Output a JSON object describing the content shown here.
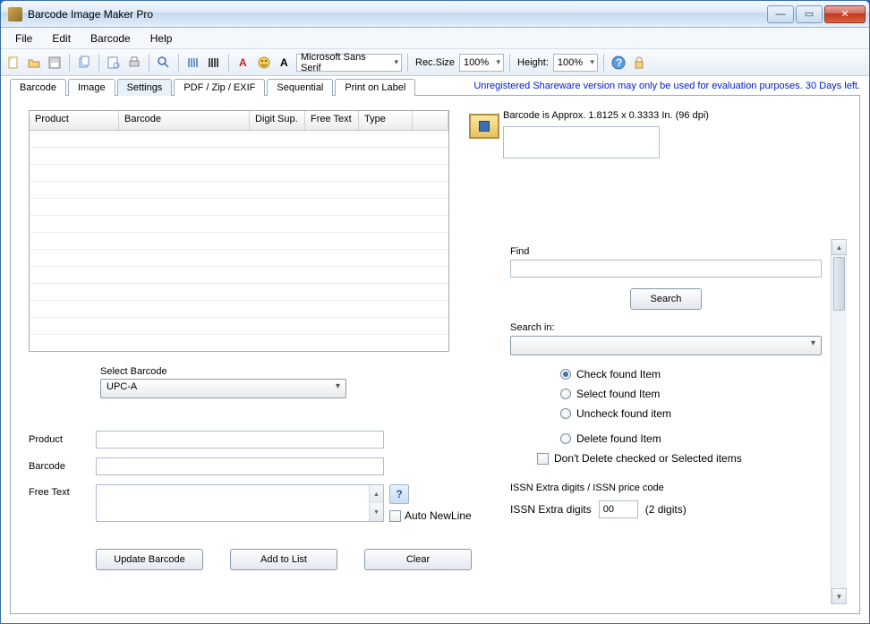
{
  "window": {
    "title": "Barcode Image Maker Pro"
  },
  "menu": {
    "file": "File",
    "edit": "Edit",
    "barcode": "Barcode",
    "help": "Help"
  },
  "toolbar": {
    "font_combo": "Microsoft Sans Serif",
    "recsize_label": "Rec.Size",
    "recsize_value": "100%",
    "height_label": "Height:",
    "height_value": "100%"
  },
  "notice": "Unregistered Shareware version may only be used for evaluation purposes. 30 Days left.",
  "tabs": {
    "barcode": "Barcode",
    "image": "Image",
    "settings": "Settings",
    "pdfzip": "PDF / Zip / EXIF",
    "sequential": "Sequential",
    "print": "Print on Label"
  },
  "grid": {
    "cols": {
      "product": "Product",
      "barcode": "Barcode",
      "digitsup": "Digit Sup.",
      "freetext": "Free Text",
      "type": "Type"
    }
  },
  "form": {
    "select_barcode_label": "Select Barcode",
    "select_barcode_value": "UPC-A",
    "product_label": "Product",
    "product_value": "",
    "barcode_label": "Barcode",
    "barcode_value": "",
    "freetext_label": "Free Text",
    "freetext_value": "",
    "auto_newline": "Auto NewLine",
    "update_btn": "Update Barcode",
    "add_btn": "Add to List",
    "clear_btn": "Clear"
  },
  "right": {
    "approx": "Barcode is Approx. 1.8125 x 0.3333 In.  (96 dpi)",
    "find_label": "Find",
    "find_value": "",
    "search_btn": "Search",
    "searchin_label": "Search in:",
    "searchin_value": "",
    "radio_check": "Check found Item",
    "radio_select": "Select found Item",
    "radio_uncheck": "Uncheck found item",
    "radio_delete": "Delete found Item",
    "dont_delete": "Don't Delete checked or Selected items",
    "issn_title": "ISSN Extra digits / ISSN price code",
    "issn_label": "ISSN Extra digits",
    "issn_value": "00",
    "issn_hint": "(2 digits)"
  }
}
